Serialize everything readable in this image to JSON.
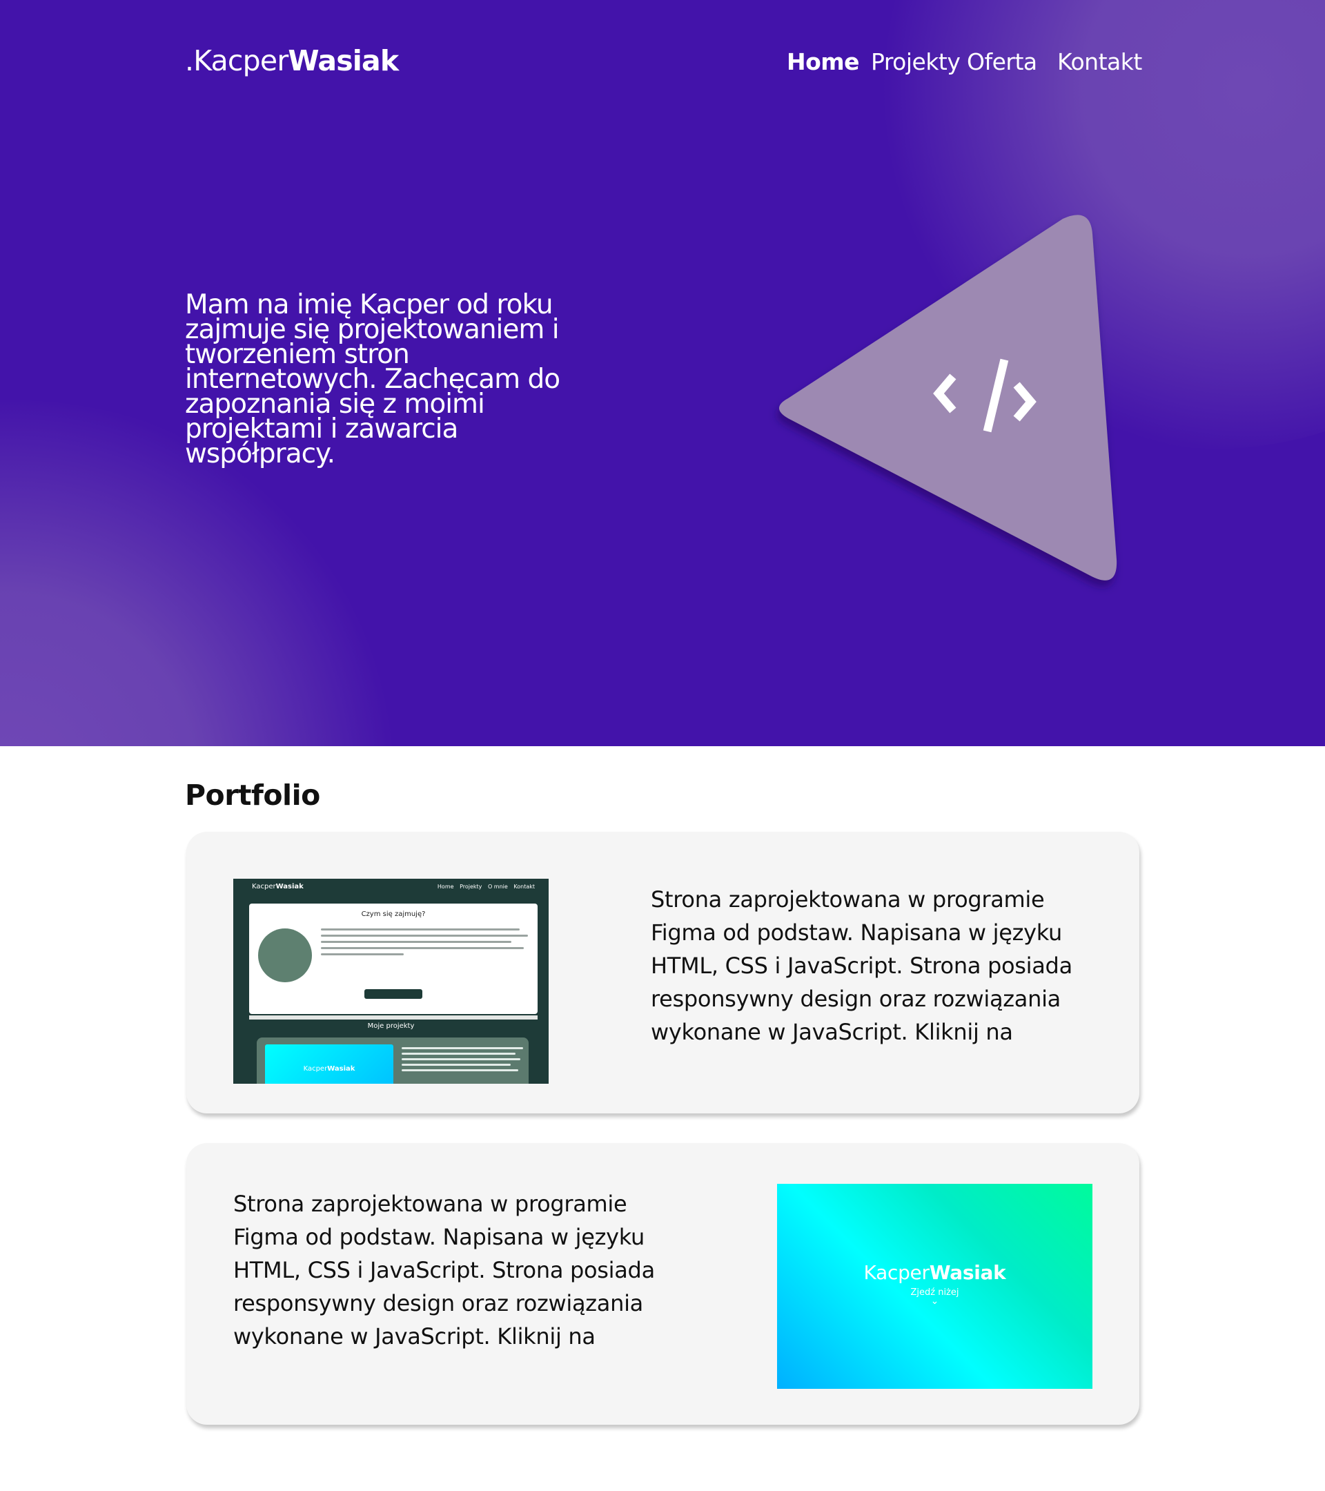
{
  "header": {
    "logo_prefix": ".Kacper",
    "logo_bold": "Wasiak",
    "nav": [
      {
        "label": "Home",
        "active": true
      },
      {
        "label": "Projekty",
        "active": false
      },
      {
        "label": "Oferta",
        "active": false
      },
      {
        "label": "Kontakt",
        "active": false
      }
    ]
  },
  "hero": {
    "text": "Mam na imię Kacper od roku zajmuje się projektowaniem i tworzeniem stron internetowych. Zachęcam do zapoznania się z moimi projektami i zawarcia współpracy.",
    "icon": "code-icon"
  },
  "portfolio": {
    "title": "Portfolio",
    "cards": [
      {
        "text": "Strona zaprojektowana w programie Figma od podstaw. Napisana w języku HTML, CSS i JavaScript. Strona posiada responsywny design oraz rozwiązania wykonane w JavaScript. Kliknij na",
        "preview": {
          "logo_prefix": "Kacper",
          "logo_bold": "Wasiak",
          "nav": [
            "Home",
            "Projekty",
            "O mnie",
            "Kontakt"
          ],
          "panel_title": "Czym się zajmuję?",
          "section_title": "Moje projekty",
          "inner_logo_prefix": "Kacper",
          "inner_logo_bold": "Wasiak"
        }
      },
      {
        "text": "Strona zaprojektowana w programie Figma od podstaw. Napisana w języku HTML, CSS i JavaScript. Strona posiada responsywny design oraz rozwiązania wykonane w JavaScript. Kliknij na",
        "preview": {
          "logo_prefix": "Kacper",
          "logo_bold": "Wasiak",
          "subtitle": "Zjedź niżej",
          "chevron": "chevron-down-icon"
        }
      }
    ]
  },
  "colors": {
    "hero_bg": "#4313aa",
    "hero_glow": "#6d48b4",
    "triangle": "#9d89b2",
    "card_bg": "#f5f5f5",
    "mock_dark": "#1e3b38"
  }
}
